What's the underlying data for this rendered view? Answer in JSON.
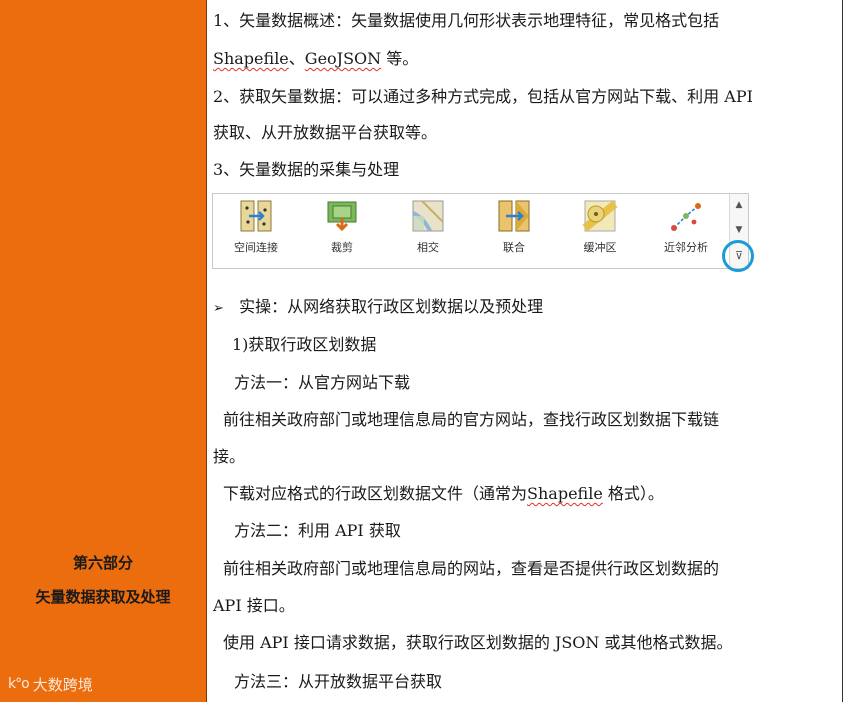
{
  "left": {
    "section_line1": "第六部分",
    "section_line2": "矢量数据获取及处理",
    "watermark_logo": "k°o",
    "watermark_text": "大数跨境"
  },
  "content": {
    "p1_a": "1、矢量数据概述：矢量数据使用几何形状表示地理特征，常见格式包括",
    "p1_b_fmt1": "Shapefile",
    "p1_b_sep": "、",
    "p1_b_fmt2": "GeoJSON",
    "p1_b_tail": " 等。",
    "p2_a": "2、获取矢量数据：可以通过多种方式完成，包括从官方网站下载、利用 API",
    "p2_b": "获取、从开放数据平台获取等。",
    "p3": "3、矢量数据的采集与处理",
    "bullet_mark": "➢",
    "practice": "实操：从网络获取行政区划数据以及预处理",
    "step1": "1)获取行政区划数据",
    "method1": "方法一：从官方网站下载",
    "m1_a": "前往相关政府部门或地理信息局的官方网站，查找行政区划数据下载链",
    "m1_b": "接。",
    "m1_c_head": "下载对应格式的行政区划数据文件（通常为",
    "m1_c_fmt": "Shapefile",
    "m1_c_tail": " 格式）。",
    "method2": "方法二：利用 API 获取",
    "m2_a": "前往相关政府部门或地理信息局的网站，查看是否提供行政区划数据的",
    "m2_b": "API 接口。",
    "m2_c": "使用 API 接口请求数据，获取行政区划数据的 JSON 或其他格式数据。",
    "method3": "方法三：从开放数据平台获取"
  },
  "toolbar": {
    "tools": [
      {
        "label": "空间连接",
        "icon": "spatial-join-icon"
      },
      {
        "label": "裁剪",
        "icon": "clip-icon"
      },
      {
        "label": "相交",
        "icon": "intersect-icon"
      },
      {
        "label": "联合",
        "icon": "union-icon"
      },
      {
        "label": "缓冲区",
        "icon": "buffer-icon"
      },
      {
        "label": "近邻分析",
        "icon": "near-icon"
      }
    ],
    "scroll_up": "▲",
    "scroll_down": "▼",
    "expand": "⊽",
    "highlight_color": "#1b9bd8"
  },
  "colors": {
    "accent": "#ec6d0e"
  }
}
